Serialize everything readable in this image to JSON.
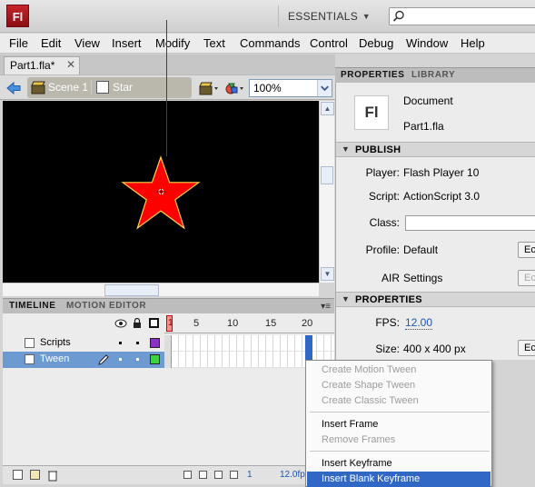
{
  "app": {
    "logo_text": "Fl",
    "workspace": "ESSENTIALS",
    "search_placeholder": ""
  },
  "menu": [
    "File",
    "Edit",
    "View",
    "Insert",
    "Modify",
    "Text",
    "Commands",
    "Control",
    "Debug",
    "Window",
    "Help"
  ],
  "document_tab": {
    "label": "Part1.fla*",
    "close_glyph": "✕"
  },
  "editbar": {
    "scene": "Scene 1",
    "symbol": "Star",
    "zoom": "100%"
  },
  "stage": {
    "background_color": "#000000",
    "star_fill": "#ff0000",
    "star_stroke": "#ffd24a"
  },
  "timeline": {
    "tabs": [
      "TIMELINE",
      "MOTION EDITOR"
    ],
    "ruler_labels": [
      "5",
      "10",
      "15",
      "20"
    ],
    "current_frame_label": "1",
    "layers": [
      {
        "name": "Scripts",
        "color": "#8a2ec6",
        "selected": false
      },
      {
        "name": "Tween",
        "color": "#3fd03f",
        "selected": true
      }
    ],
    "footer_frame": "1",
    "footer_fps": "12.0fp"
  },
  "properties": {
    "tabs": [
      "PROPERTIES",
      "LIBRARY"
    ],
    "doc_icon_text": "Fl",
    "doc_type": "Document",
    "doc_name": "Part1.fla",
    "publish": {
      "header": "PUBLISH",
      "player_label": "Player:",
      "player_value": "Flash Player 10",
      "script_label": "Script:",
      "script_value": "ActionScript 3.0",
      "class_label": "Class:",
      "class_value": "",
      "profile_label": "Profile:",
      "profile_value": "Default",
      "air_label": "AIR",
      "air_value": "Settings",
      "edit_label": "Ec"
    },
    "properties_section": {
      "header": "PROPERTIES",
      "fps_label": "FPS:",
      "fps_value": "12.00",
      "size_label": "Size:",
      "size_value": "400 x 400 px",
      "edit_label": "Ec"
    }
  },
  "context_menu": {
    "items": [
      {
        "label": "Create Motion Tween",
        "state": "disabled"
      },
      {
        "label": "Create Shape Tween",
        "state": "disabled"
      },
      {
        "label": "Create Classic Tween",
        "state": "disabled"
      },
      {
        "label": "Insert Frame",
        "state": "enabled"
      },
      {
        "label": "Remove Frames",
        "state": "disabled"
      },
      {
        "label": "Insert Keyframe",
        "state": "enabled"
      },
      {
        "label": "Insert Blank Keyframe",
        "state": "highlighted"
      }
    ]
  }
}
